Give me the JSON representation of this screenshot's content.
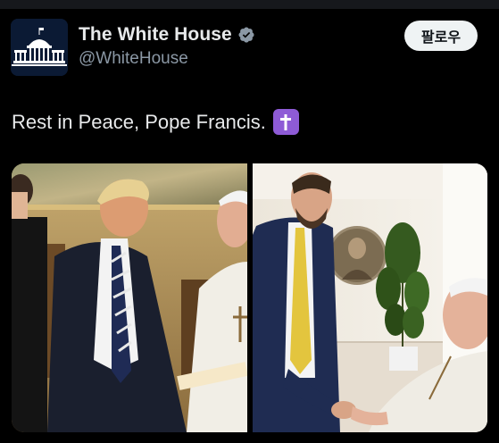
{
  "account": {
    "display_name": "The White House",
    "handle": "@WhiteHouse",
    "verified": true,
    "verified_color": "#8b98a5",
    "avatar_icon": "white-house-building-icon"
  },
  "follow_button": {
    "label": "팔로우"
  },
  "tweet": {
    "text": "Rest in Peace, Pope Francis.",
    "emoji": "latin-cross-emoji",
    "emoji_glyph": "✝"
  },
  "media": {
    "photos": [
      "left-photo",
      "right-photo"
    ]
  },
  "colors": {
    "background": "#000000",
    "text_primary": "#e7e9ea",
    "text_secondary": "#8b98a5",
    "button_bg": "#eff3f4",
    "emoji_bg": "#8e5bd6"
  }
}
